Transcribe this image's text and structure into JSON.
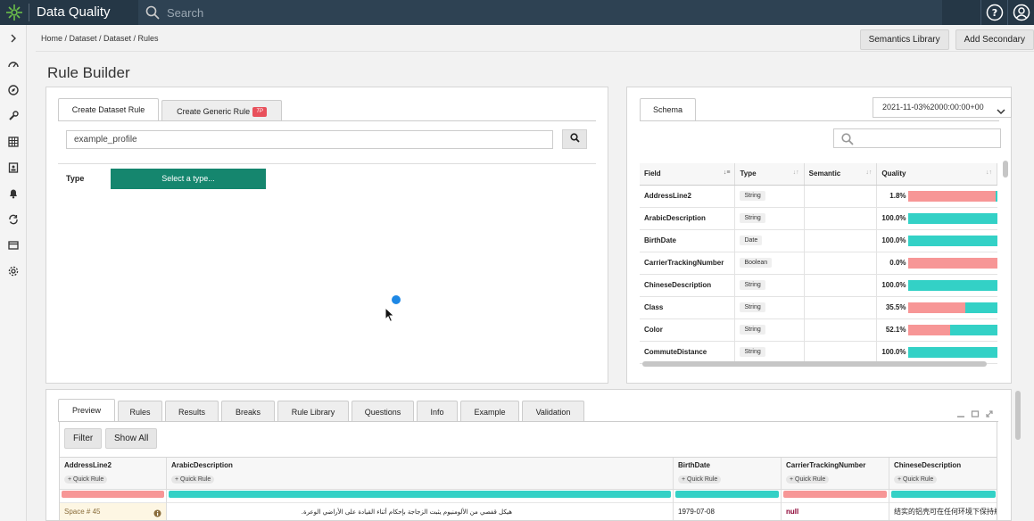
{
  "app": {
    "title": "Data Quality",
    "search_placeholder": "Search"
  },
  "breadcrumb": "Home / Dataset / Dataset / Rules",
  "top_actions": {
    "semantics_library": "Semantics Library",
    "add_secondary": "Add Secondary"
  },
  "page_title": "Rule Builder",
  "rule_tabs": {
    "create_dataset_rule": "Create Dataset Rule",
    "create_generic_rule": "Create Generic Rule",
    "tp_badge": "TP"
  },
  "profile_input": "example_profile",
  "type_section": {
    "label": "Type",
    "select_label": "Select a type..."
  },
  "schema": {
    "tab": "Schema",
    "date_value": "2021-11-03%2000:00:00+00",
    "columns": [
      "Field",
      "Type",
      "Semantic",
      "Quality"
    ],
    "rows": [
      {
        "field": "AddressLine2",
        "type": "String",
        "semantic": "",
        "pct": "1.8%",
        "quality": 0.018
      },
      {
        "field": "ArabicDescription",
        "type": "String",
        "semantic": "",
        "pct": "100.0%",
        "quality": 1.0
      },
      {
        "field": "BirthDate",
        "type": "Date",
        "semantic": "",
        "pct": "100.0%",
        "quality": 1.0
      },
      {
        "field": "CarrierTrackingNumber",
        "type": "Boolean",
        "semantic": "",
        "pct": "0.0%",
        "quality": 0.0
      },
      {
        "field": "ChineseDescription",
        "type": "String",
        "semantic": "",
        "pct": "100.0%",
        "quality": 1.0
      },
      {
        "field": "Class",
        "type": "String",
        "semantic": "",
        "pct": "35.5%",
        "quality": 0.355
      },
      {
        "field": "Color",
        "type": "String",
        "semantic": "",
        "pct": "52.1%",
        "quality": 0.521
      },
      {
        "field": "CommuteDistance",
        "type": "String",
        "semantic": "",
        "pct": "100.0%",
        "quality": 1.0
      }
    ]
  },
  "bottom_tabs": [
    "Preview",
    "Rules",
    "Results",
    "Breaks",
    "Rule Library",
    "Questions",
    "Info",
    "Example",
    "Validation"
  ],
  "preview": {
    "filter": "Filter",
    "show_all": "Show All",
    "quick_rule": "+ Quick Rule",
    "columns": [
      {
        "name": "AddressLine2",
        "value": "Space # 45",
        "bar": "#f79696"
      },
      {
        "name": "ArabicDescription",
        "value": "هيكل قفصي من الألومنيوم يثبت الزجاجة بإحكام أثناء القيادة على الأراضي الوعرة.",
        "bar": "#33d1c6"
      },
      {
        "name": "BirthDate",
        "value": "1979-07-08",
        "bar": "#33d1c6"
      },
      {
        "name": "CarrierTrackingNumber",
        "value": "null",
        "bar": "#f79696"
      },
      {
        "name": "ChineseDescription",
        "value": "结实的铝壳可在任何环境下保持瓶",
        "bar": "#33d1c6"
      }
    ]
  },
  "colors": {
    "topbar": "#253746",
    "accent_green": "#15866e",
    "quality_good": "#33d1c6",
    "quality_bad": "#f79696"
  }
}
